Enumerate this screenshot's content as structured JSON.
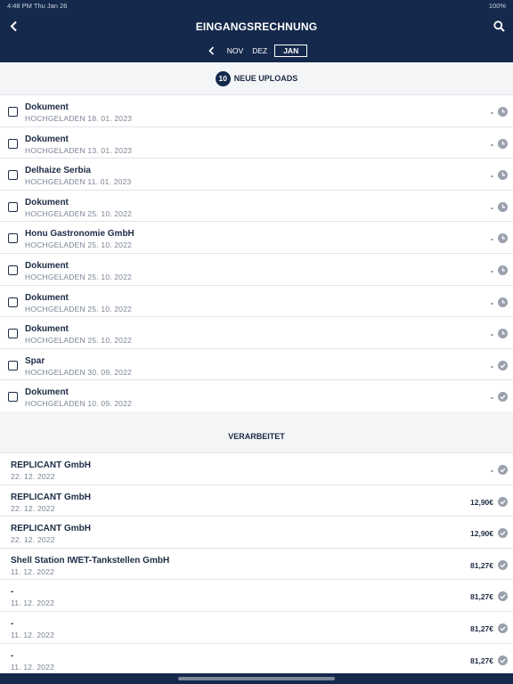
{
  "status_bar": {
    "time": "4:48 PM   Thu Jan 26",
    "battery": "100%"
  },
  "header": {
    "title": "EINGANGSRECHNUNG"
  },
  "months": [
    "NOV",
    "DEZ",
    "JAN"
  ],
  "uploads": {
    "count": "10",
    "title": "NEUE UPLOADS",
    "items": [
      {
        "name": "Dokument",
        "date": "HOCHGELADEN 18. 01. 2023",
        "amount": "-",
        "status": "clock-icon"
      },
      {
        "name": "Dokument",
        "date": "HOCHGELADEN 13. 01. 2023",
        "amount": "-",
        "status": "clock-icon"
      },
      {
        "name": "Delhaize Serbia",
        "date": "HOCHGELADEN 11. 01. 2023",
        "amount": "-",
        "status": "clock-icon"
      },
      {
        "name": "Dokument",
        "date": "HOCHGELADEN 25. 10. 2022",
        "amount": "-",
        "status": "clock-icon"
      },
      {
        "name": "Honu Gastronomie GmbH",
        "date": "HOCHGELADEN 25. 10. 2022",
        "amount": "-",
        "status": "clock-icon"
      },
      {
        "name": "Dokument",
        "date": "HOCHGELADEN 25. 10. 2022",
        "amount": "-",
        "status": "clock-icon"
      },
      {
        "name": "Dokument",
        "date": "HOCHGELADEN 25. 10. 2022",
        "amount": "-",
        "status": "clock-icon"
      },
      {
        "name": "Dokument",
        "date": "HOCHGELADEN 25. 10. 2022",
        "amount": "-",
        "status": "clock-icon"
      },
      {
        "name": "Spar",
        "date": "HOCHGELADEN 30. 09. 2022",
        "amount": "-",
        "status": "check-icon"
      },
      {
        "name": "Dokument",
        "date": "HOCHGELADEN 10. 09. 2022",
        "amount": "-",
        "status": "check-icon"
      }
    ]
  },
  "processed": {
    "title": "VERARBEITET",
    "items": [
      {
        "name": "REPLICANT GmbH",
        "date": "22. 12. 2022",
        "amount": "-",
        "status": "check-icon"
      },
      {
        "name": "REPLICANT GmbH",
        "date": "22. 12. 2022",
        "amount": "12,90€",
        "status": "check-icon"
      },
      {
        "name": "REPLICANT GmbH",
        "date": "22. 12. 2022",
        "amount": "12,90€",
        "status": "check-icon"
      },
      {
        "name": "Shell Station IWET-Tankstellen GmbH",
        "date": "11. 12. 2022",
        "amount": "81,27€",
        "status": "check-icon"
      },
      {
        "name": "-",
        "date": "11. 12. 2022",
        "amount": "81,27€",
        "status": "check-icon"
      },
      {
        "name": "-",
        "date": "11. 12. 2022",
        "amount": "81,27€",
        "status": "check-icon"
      },
      {
        "name": "-",
        "date": "11. 12. 2022",
        "amount": "81,27€",
        "status": "check-icon"
      }
    ]
  },
  "colors": {
    "header_bg": "#15294c",
    "icon_gray": "#9aa1ad"
  }
}
